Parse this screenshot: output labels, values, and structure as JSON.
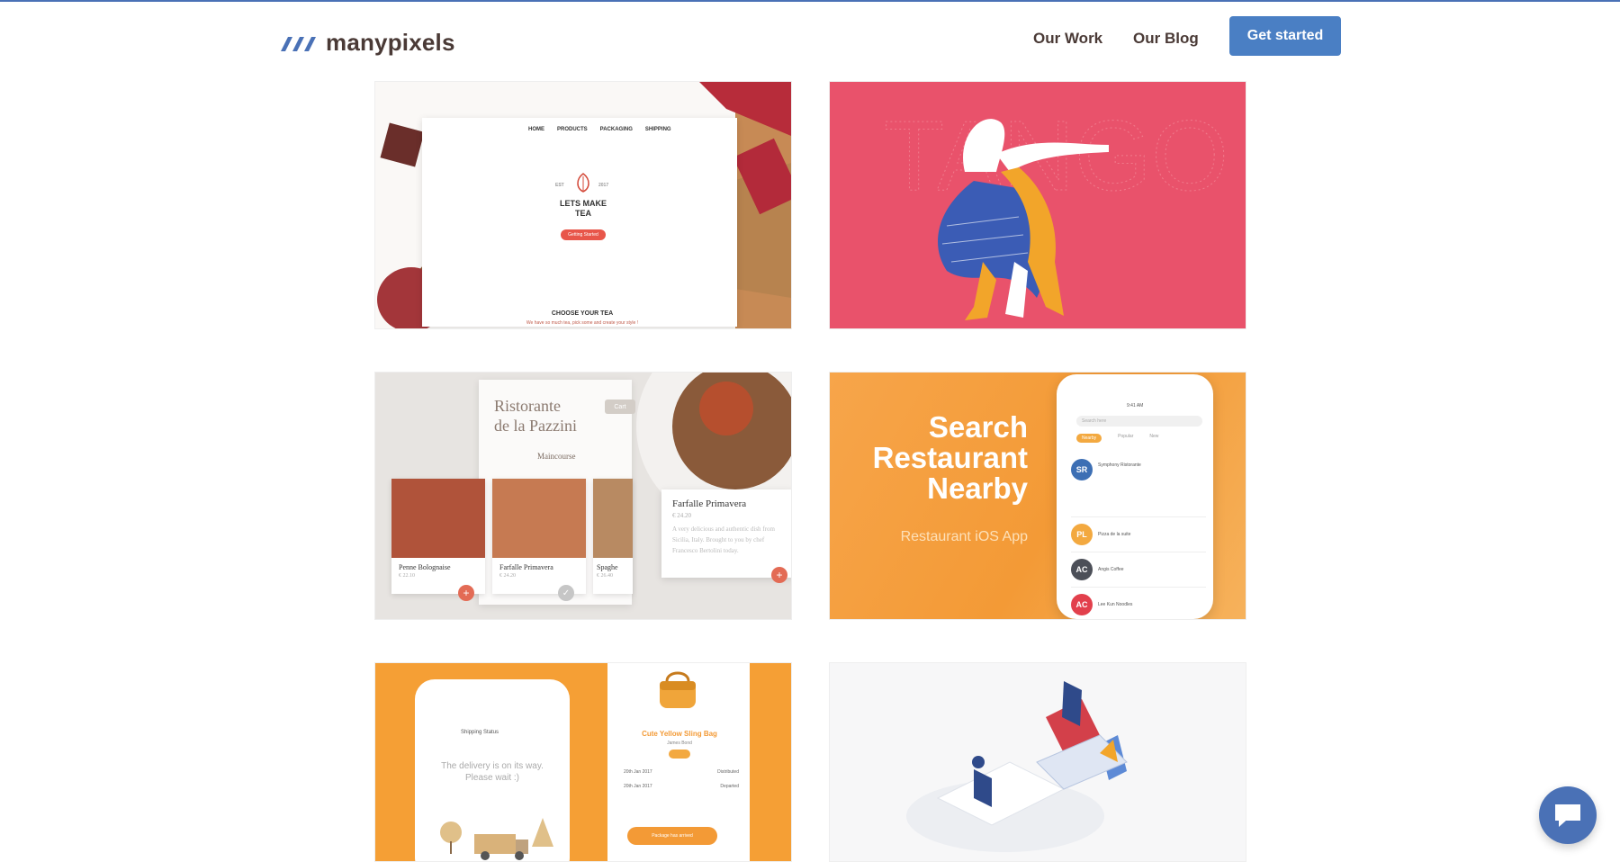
{
  "brand": {
    "name": "manypixels"
  },
  "nav": {
    "work": "Our Work",
    "blog": "Our Blog",
    "cta": "Get started"
  },
  "card_tea": {
    "nav": [
      "HOME",
      "PRODUCTS",
      "PACKAGING",
      "SHIPPING"
    ],
    "est": "EST",
    "year": "2017",
    "title_line1": "LETS MAKE",
    "title_line2": "TEA",
    "button": "Getting Started",
    "section": "CHOOSE YOUR TEA",
    "tagline": "We have so much tea, pick some and create your style !"
  },
  "card_restaurant": {
    "title_line1": "Ristorante",
    "title_line2": "de la Pazzini",
    "cart": "Cart",
    "tabs": [
      "Maincourse"
    ],
    "items": [
      {
        "name": "Penne Bolognaise",
        "price": "€ 22.10"
      },
      {
        "name": "Farfalle Primavera",
        "price": "€ 24.20"
      },
      {
        "name": "Spaghe",
        "price": "€ 26.40"
      }
    ],
    "detail_name": "Farfalle Primavera",
    "detail_price": "€ 24.20",
    "detail_text": "A very delicious and authentic dish from Sicilia, Italy. Brought to you by chef Francesco Bertolini today."
  },
  "card_search": {
    "line1": "Search",
    "line2": "Restaurant",
    "line3": "Nearby",
    "subtitle": "Restaurant iOS App",
    "phone_time": "9:41 AM",
    "search_placeholder": "Search here",
    "tabs": [
      "Nearby",
      "Popular",
      "New"
    ],
    "list": [
      {
        "initials": "SR",
        "name": "Symphony Ristorante",
        "color": "#3d6fb4"
      },
      {
        "initials": "PL",
        "name": "Pizza de la suite",
        "color": "#f3a940"
      },
      {
        "initials": "AC",
        "name": "Angis Coffee",
        "color": "#4c4f58"
      },
      {
        "initials": "AC",
        "name": "Lee Kun Noodles",
        "color": "#e2404c"
      }
    ]
  },
  "card_delivery": {
    "header": "Shipping Status",
    "message_line1": "The delivery is on its way.",
    "message_line2": "Please wait :)",
    "product": "Cute Yellow Sling Bag",
    "product_by": "James Bond",
    "rows": [
      {
        "date": "20th Jan 2017",
        "status": "Distributed"
      },
      {
        "date": "20th Jan 2017",
        "status": "Departed"
      }
    ],
    "button": "Package has arrived"
  },
  "colors": {
    "accent": "#4a7fc4",
    "pink": "#e9526b",
    "orange": "#f59f35"
  }
}
